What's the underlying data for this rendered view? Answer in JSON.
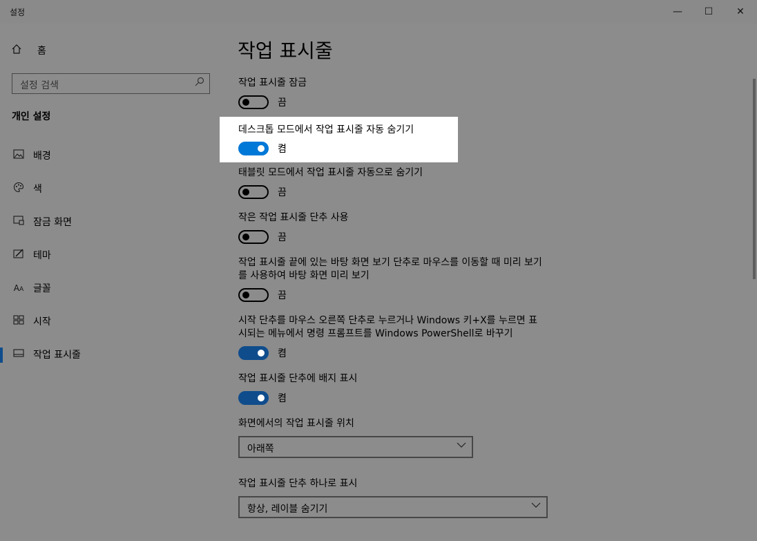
{
  "window": {
    "title": "설정",
    "minimize": "—",
    "maximize": "☐",
    "close": "✕"
  },
  "sidebar": {
    "home_label": "홈",
    "search_placeholder": "설정 검색",
    "section_title": "개인 설정",
    "items": [
      {
        "label": "배경",
        "icon": "image-icon"
      },
      {
        "label": "색",
        "icon": "palette-icon"
      },
      {
        "label": "잠금 화면",
        "icon": "lock-screen-icon"
      },
      {
        "label": "테마",
        "icon": "theme-icon"
      },
      {
        "label": "글꼴",
        "icon": "font-icon"
      },
      {
        "label": "시작",
        "icon": "start-icon"
      },
      {
        "label": "작업 표시줄",
        "icon": "taskbar-icon",
        "selected": true
      }
    ]
  },
  "content": {
    "title": "작업 표시줄",
    "settings": [
      {
        "label": "작업 표시줄 잠금",
        "state": "끔",
        "on": false
      },
      {
        "label": "데스크톱 모드에서 작업 표시줄 자동 숨기기",
        "state": "켬",
        "on": true
      },
      {
        "label": "태블릿 모드에서 작업 표시줄 자동으로 숨기기",
        "state": "끔",
        "on": false
      },
      {
        "label": "작은 작업 표시줄 단추 사용",
        "state": "끔",
        "on": false
      },
      {
        "label": "작업 표시줄 끝에 있는 바탕 화면 보기 단추로 마우스를 이동할 때 미리 보기를 사용하여 바탕 화면 미리 보기",
        "state": "끔",
        "on": false
      },
      {
        "label": "시작 단추를 마우스 오른쪽 단추로 누르거나 Windows 키+X를 누르면 표시되는 메뉴에서 명령 프롬프트를 Windows PowerShell로 바꾸기",
        "state": "켬",
        "on": true
      },
      {
        "label": "작업 표시줄 단추에 배지 표시",
        "state": "켬",
        "on": true
      }
    ],
    "position": {
      "label": "화면에서의 작업 표시줄 위치",
      "value": "아래쪽"
    },
    "combine": {
      "label": "작업 표시줄 단추 하나로 표시",
      "value": "항상, 레이블 숨기기"
    }
  },
  "colors": {
    "accent": "#0078d7",
    "accent_dim": "#0f4c8c",
    "highlight_bg": "#ffffff"
  }
}
